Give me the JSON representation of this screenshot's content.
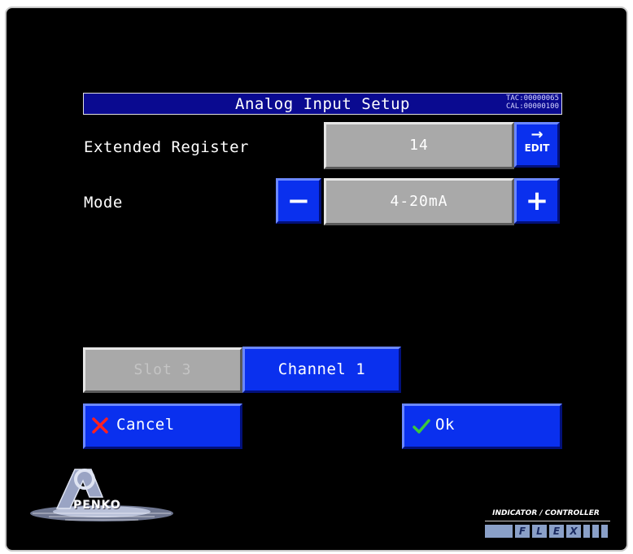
{
  "header": {
    "title": "Analog Input Setup",
    "tac": "TAC:00000065",
    "cal": "CAL:00000100"
  },
  "extended_register": {
    "label": "Extended Register",
    "value": "14",
    "edit_label": "EDIT"
  },
  "mode": {
    "label": "Mode",
    "value": "4-20mA",
    "minus": "−",
    "plus": "+"
  },
  "selectors": {
    "slot": "Slot 3",
    "channel": "Channel 1"
  },
  "actions": {
    "cancel": "Cancel",
    "ok": "Ok"
  },
  "branding": {
    "company": "PENKO",
    "product_line": "INDICATOR / CONTROLLER",
    "product_letters": [
      "F",
      "L",
      "E",
      "X"
    ]
  },
  "colors": {
    "button_blue": "#0a30ee",
    "title_bar": "#0a0a90",
    "field_gray": "#a9a9a9",
    "cancel_icon": "#ff2020",
    "ok_icon": "#3cc83c"
  }
}
